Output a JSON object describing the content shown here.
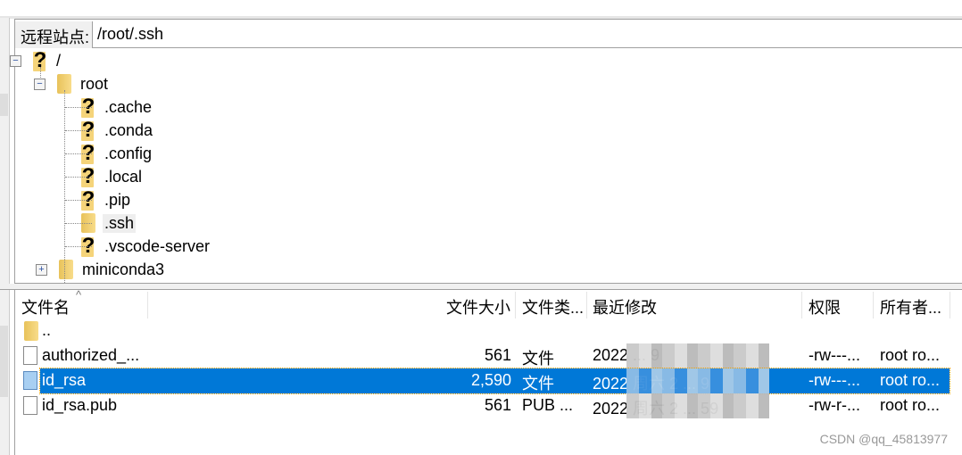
{
  "remote_site": {
    "label": "远程站点:",
    "path": "/root/.ssh"
  },
  "tree": [
    {
      "name": "/",
      "icon": "unknown-folder-icon",
      "expander": "minus"
    },
    {
      "name": "root",
      "icon": "folder-icon",
      "expander": "minus"
    },
    {
      "name": ".cache",
      "icon": "unknown-folder-icon"
    },
    {
      "name": ".conda",
      "icon": "unknown-folder-icon"
    },
    {
      "name": ".config",
      "icon": "unknown-folder-icon"
    },
    {
      "name": ".local",
      "icon": "unknown-folder-icon"
    },
    {
      "name": ".pip",
      "icon": "unknown-folder-icon"
    },
    {
      "name": ".ssh",
      "icon": "folder-icon",
      "selected": true
    },
    {
      "name": ".vscode-server",
      "icon": "unknown-folder-icon"
    },
    {
      "name": "miniconda3",
      "icon": "folder-icon",
      "expander": "plus"
    }
  ],
  "columns": {
    "name": "文件名",
    "size": "文件大小",
    "type": "文件类...",
    "modified": "最近修改",
    "perms": "权限",
    "owner": "所有者..."
  },
  "files": [
    {
      "name": "..",
      "size": "",
      "type": "",
      "modified": "",
      "perms": "",
      "owner": ""
    },
    {
      "name": "authorized_...",
      "size": "561",
      "type": "文件",
      "modified": "2022 ... 9",
      "perms": "-rw---...",
      "owner": "root ro..."
    },
    {
      "name": "id_rsa",
      "size": "2,590",
      "type": "文件",
      "modified": "2022 周六 2 ... 9",
      "perms": "-rw---...",
      "owner": "root ro...",
      "selected": true
    },
    {
      "name": "id_rsa.pub",
      "size": "561",
      "type": "PUB ...",
      "modified": "2022 周六 2 ... 59",
      "perms": "-rw-r-...",
      "owner": "root ro..."
    }
  ],
  "watermark": "CSDN @qq_45813977",
  "colors": {
    "selection": "#0078d7"
  }
}
